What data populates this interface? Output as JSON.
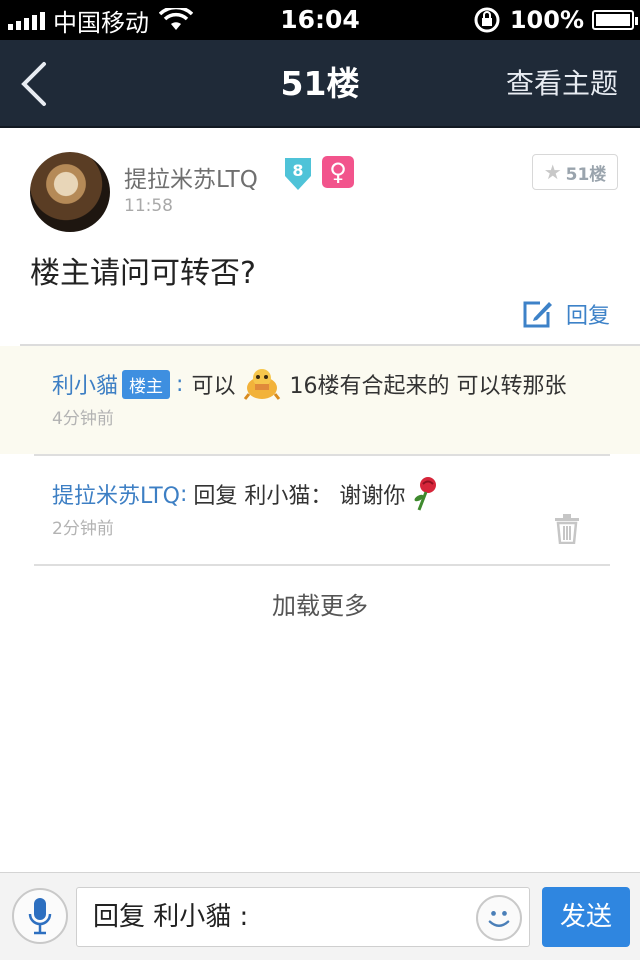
{
  "status_bar": {
    "carrier": "中国移动",
    "time": "16:04",
    "battery": "100%",
    "battery_level": 1.0
  },
  "nav": {
    "back_icon": "chevron-left-icon",
    "title": "51楼",
    "view_topic": "查看主题"
  },
  "post": {
    "username": "提拉米苏LTQ",
    "level": "8",
    "gender_symbol": "♀",
    "time": "11:58",
    "floor": "51楼",
    "content": "楼主请问可转否?",
    "reply_label": "回复"
  },
  "comments": [
    {
      "author": "利小貓",
      "op_badge": "楼主",
      "sep": ":",
      "text_before": "可以",
      "text_after": "16楼有合起来的 可以转那张",
      "time": "4分钟前"
    },
    {
      "author": "提拉米苏LTQ",
      "sep": ":",
      "text": "回复 利小猫： 谢谢你",
      "time": "2分钟前"
    }
  ],
  "load_more": "加载更多",
  "input_bar": {
    "value": "回复 利小貓 :",
    "send_label": "发送"
  },
  "colors": {
    "nav_bg": "#1f2a38",
    "link_blue": "#3d7fc4",
    "send_blue": "#2f86e0",
    "female_pink": "#f2548c",
    "level_teal": "#4fc3d8",
    "highlight_bg": "#fbfaf0"
  }
}
